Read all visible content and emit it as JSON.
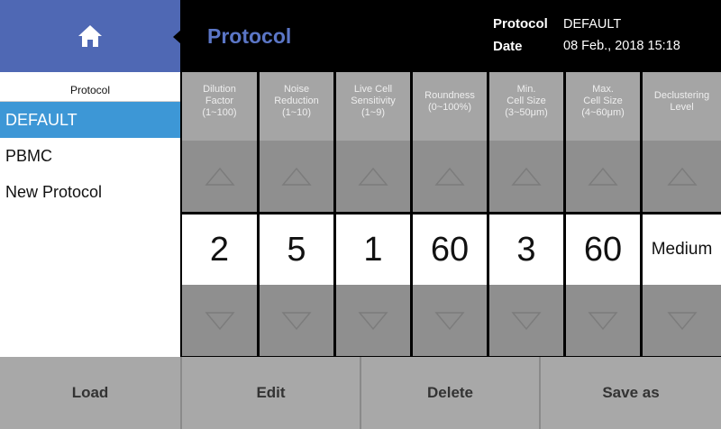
{
  "header": {
    "home_icon": "home-icon",
    "title": "Protocol",
    "protocol_label": "Protocol",
    "protocol_value": "DEFAULT",
    "date_label": "Date",
    "date_value": "08 Feb., 2018 15:18"
  },
  "sidebar": {
    "heading": "Protocol",
    "items": [
      {
        "label": "DEFAULT",
        "selected": true
      },
      {
        "label": "PBMC",
        "selected": false
      },
      {
        "label": "New Protocol",
        "selected": false
      }
    ]
  },
  "parameters": [
    {
      "line1": "Dilution",
      "line2": "Factor",
      "line3": "(1~100)",
      "value": "2"
    },
    {
      "line1": "Noise",
      "line2": "Reduction",
      "line3": "(1~10)",
      "value": "5"
    },
    {
      "line1": "Live Cell",
      "line2": "Sensitivity",
      "line3": "(1~9)",
      "value": "1"
    },
    {
      "line1": "Roundness",
      "line2": "(0~100%)",
      "line3": "",
      "value": "60"
    },
    {
      "line1": "Min.",
      "line2": "Cell Size",
      "line3": "(3~50μm)",
      "value": "3"
    },
    {
      "line1": "Max.",
      "line2": "Cell Size",
      "line3": "(4~60μm)",
      "value": "60"
    },
    {
      "line1": "Declustering",
      "line2": "Level",
      "line3": "",
      "value": "Medium"
    }
  ],
  "toolbar": {
    "load_label": "Load",
    "edit_label": "Edit",
    "delete_label": "Delete",
    "save_as_label": "Save as"
  },
  "colors": {
    "accent_blue": "#4f68b4",
    "title_blue": "#5b76c6",
    "selected_blue": "#3d97d6",
    "grid_gray": "#8f8f8f",
    "header_gray": "#a5a5a5"
  }
}
